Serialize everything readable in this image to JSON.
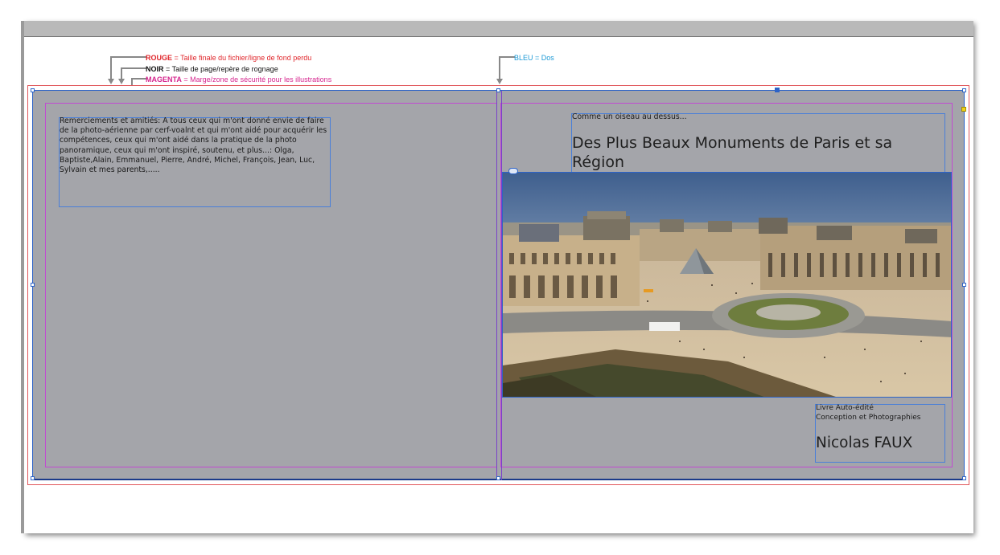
{
  "legend": {
    "rouge_key": "ROUGE",
    "rouge_text": " = Taille finale du fichier/ligne de fond perdu",
    "noir_key": "NOIR",
    "noir_text": " = Taille de page/repère de rognage",
    "magenta_key": "MAGENTA",
    "magenta_text": " = Marge/zone de sécurité pour les illustrations",
    "bleu_text": "BLEU = Dos"
  },
  "back_cover": {
    "thanks_text": "Remerciements et amitiés: A tous ceux qui m'ont donné envie de faire de la photo-aérienne par cerf-voalnt et qui m'ont aidé pour acquérir les compétences, ceux qui m'ont aidé dans la pratique de la photo panoramique, ceux qui m'ont inspiré, soutenu, et plus...: Olga, Baptiste,Alain, Emmanuel, Pierre, André, Michel, François, Jean, Luc, Sylvain et mes parents,....."
  },
  "front_cover": {
    "subtitle": "Comme un oiseau au dessus...",
    "title": "Des Plus Beaux Monuments de Paris et sa Région",
    "author_info": "Livre Auto-édité\nConception et Photographies",
    "author_name": "Nicolas FAUX"
  },
  "colors": {
    "rouge": "#e0262b",
    "noir": "#111111",
    "magenta": "#d6268e",
    "bleu": "#1e9ad6",
    "cover_fill": "#a4a5aa"
  },
  "icons": {
    "frame_link": "link-icon",
    "arrows": "arrow-down-icon"
  }
}
